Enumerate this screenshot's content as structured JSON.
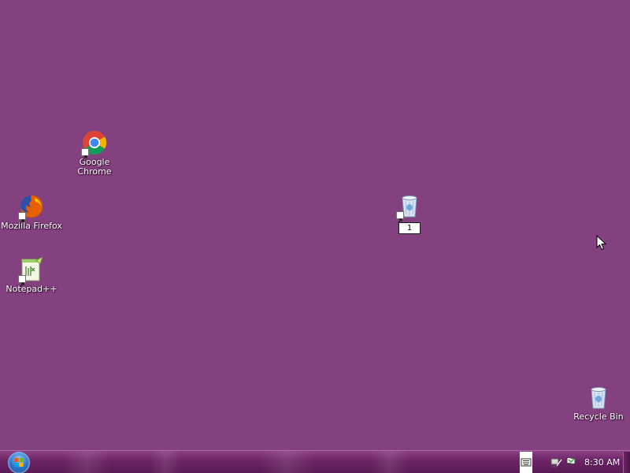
{
  "desktop": {
    "background_color": "#84417f",
    "icons": [
      {
        "label_line1": "Google",
        "label_line2": "Chrome",
        "icon": "chrome-icon",
        "shortcut": true
      },
      {
        "label": "Mozilla Firefox",
        "icon": "firefox-icon",
        "shortcut": true
      },
      {
        "label": "Notepad++",
        "icon": "notepadpp-icon",
        "shortcut": true
      },
      {
        "rename_value": "1",
        "icon": "recycle-bin-icon",
        "shortcut": true
      },
      {
        "label": "Recycle Bin",
        "icon": "recycle-bin-icon",
        "shortcut": false
      }
    ]
  },
  "taskbar": {
    "start_icon": "windows-orb-icon",
    "tray_icons": [
      "keyboard-icon",
      "network-icon",
      "action-center-icon"
    ],
    "clock": "8:30 AM"
  }
}
